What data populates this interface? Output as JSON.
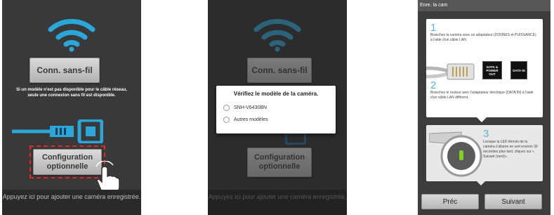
{
  "panel1": {
    "wifi_button": "Conn. sans-fil",
    "note": "Si un modèle n'est pas disponible pour le câble réseau, seule une connexion sans fil est disponible.",
    "config_button": "Configuration optionnelle",
    "footer": "Appuyez ici pour ajouter une caméra enregistrée."
  },
  "panel2": {
    "wifi_button": "Conn. sans-fil",
    "config_button": "Configuration optionnelle",
    "footer": "Appuyez ici pour ajouter une caméra enregistrée.",
    "dialog": {
      "title": "Vérifiez le modèle de la caméra.",
      "options": [
        "SNH-V6430BN",
        "Autres modèles"
      ]
    }
  },
  "panel3": {
    "title": "Enre. la cam",
    "step1": {
      "num": "1",
      "text": "Branchez la caméra avec un adaptateur (DONNES et PUISSANCE) à l'aide d'un câble LAN.",
      "label_a": "DATA & POWER OUT",
      "label_b": "DATA IN"
    },
    "step2": {
      "num": "2",
      "text": "Branchez le routeur avec l'adaptateur électrique (DATA IN) à l'aide d'un câble LAN différent."
    },
    "step3": {
      "num": "3",
      "text": "Lorsque la LED témoin de la caméra s'allume en vert environ 30 secondes plus tard, cliquez sur « Suivant (next)»."
    },
    "prev_button": "Préc",
    "next_button": "Suivant"
  },
  "colors": {
    "wifi_blue": "#2ba6d9",
    "highlight_red": "#e0272d",
    "step_blue": "#59b4d9",
    "led_green": "#7ed321"
  }
}
